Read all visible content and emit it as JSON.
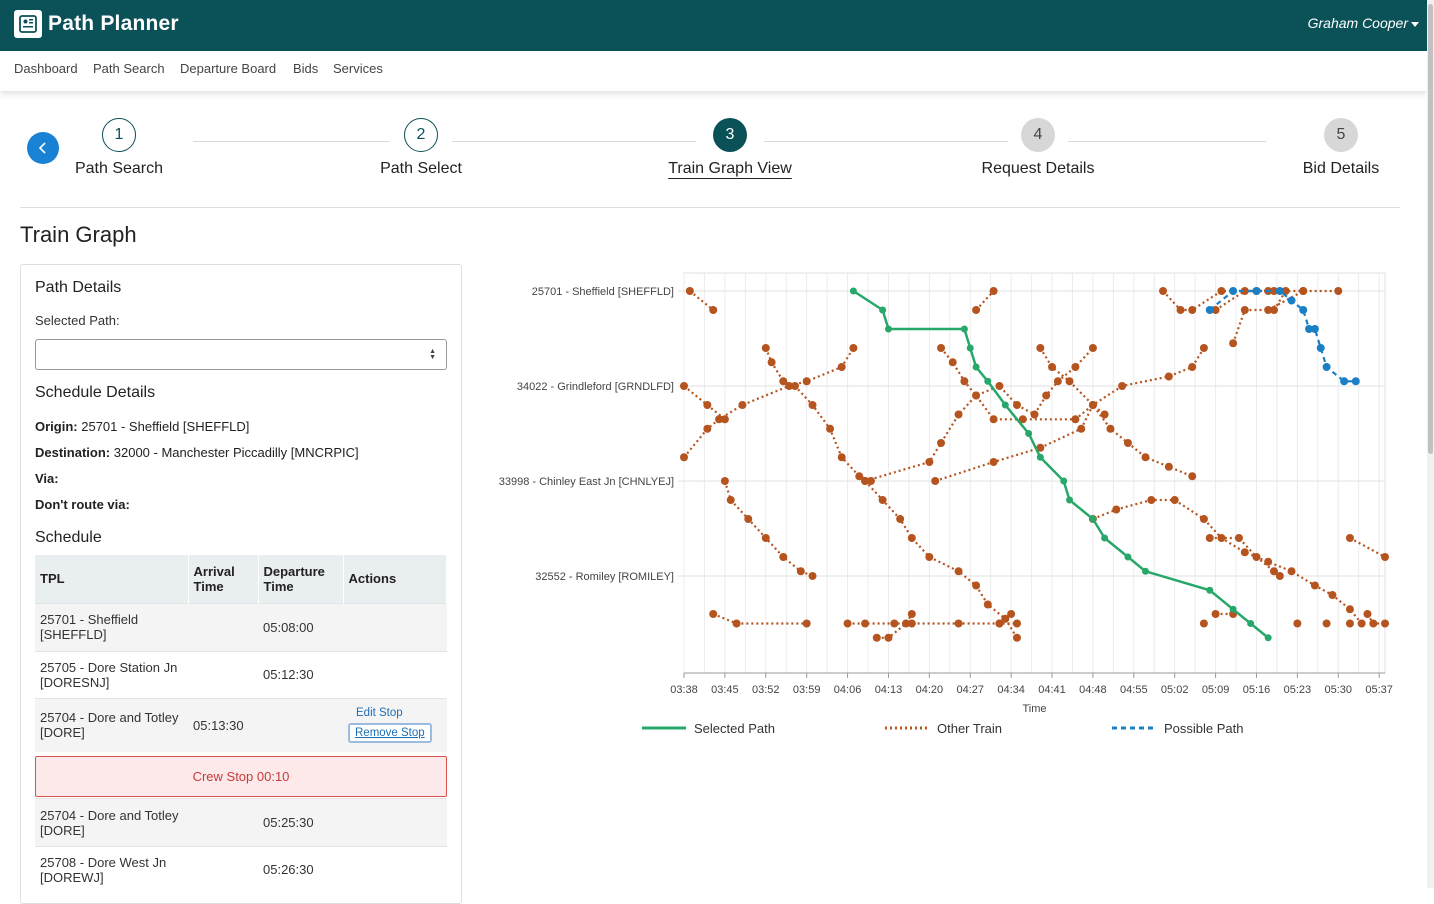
{
  "app": {
    "title": "Path Planner",
    "user": "Graham Cooper"
  },
  "nav": {
    "items": [
      "Dashboard",
      "Path Search",
      "Departure Board",
      "Bids",
      "Services"
    ]
  },
  "stepper": {
    "steps": [
      {
        "num": "1",
        "label": "Path Search",
        "state": "done"
      },
      {
        "num": "2",
        "label": "Path Select",
        "state": "done"
      },
      {
        "num": "3",
        "label": "Train Graph View",
        "state": "active"
      },
      {
        "num": "4",
        "label": "Request Details",
        "state": "todo"
      },
      {
        "num": "5",
        "label": "Bid Details",
        "state": "todo"
      }
    ]
  },
  "page": {
    "title": "Train Graph"
  },
  "path_details": {
    "heading": "Path Details",
    "selected_path_label": "Selected Path:",
    "selected_path_value": ""
  },
  "schedule_details": {
    "heading": "Schedule Details",
    "origin_label": "Origin:",
    "origin_value": "25701 - Sheffield [SHEFFLD]",
    "destination_label": "Destination:",
    "destination_value": "32000 - Manchester Piccadilly [MNCRPIC]",
    "via_label": "Via:",
    "dont_route_label": "Don't route via:"
  },
  "schedule": {
    "heading": "Schedule",
    "columns": [
      "TPL",
      "Arrival Time",
      "Departure Time",
      "Actions"
    ],
    "rows": [
      {
        "tpl": "25701 - Sheffield [SHEFFLD]",
        "arrival": "",
        "departure": "05:08:00",
        "actions": []
      },
      {
        "tpl": "25705 - Dore Station Jn [DORESNJ]",
        "arrival": "",
        "departure": "05:12:30",
        "actions": []
      },
      {
        "tpl": "25704 - Dore and Totley [DORE]",
        "arrival": "05:13:30",
        "departure": "",
        "actions": [
          "Edit Stop",
          "Remove Stop"
        ]
      },
      {
        "tpl": "25704 - Dore and Totley [DORE]",
        "arrival": "",
        "departure": "05:25:30",
        "actions": []
      },
      {
        "tpl": "25708 - Dore West Jn [DOREWJ]",
        "arrival": "",
        "departure": "05:26:30",
        "actions": []
      }
    ],
    "crew_stop": "Crew Stop 00:10"
  },
  "colors": {
    "selected": "#27a86a",
    "other": "#b5541f",
    "possible": "#1a7fc4",
    "header": "#0b5158"
  },
  "chart_data": {
    "type": "line",
    "xlabel": "Time",
    "x_ticks": [
      "03:38",
      "03:45",
      "03:52",
      "03:59",
      "04:06",
      "04:13",
      "04:20",
      "04:27",
      "04:34",
      "04:41",
      "04:48",
      "04:55",
      "05:02",
      "05:09",
      "05:16",
      "05:23",
      "05:30",
      "05:37"
    ],
    "xlim": [
      "03:38",
      "05:38"
    ],
    "y_stations": [
      "25701 - Sheffield [SHEFFLD]",
      "34022 - Grindleford [GRNDLFD]",
      "33998 - Chinley East Jn [CHNLYEJ]",
      "32552 - Romiley [ROMILEY]"
    ],
    "ylim": [
      0,
      4
    ],
    "legend": [
      "Selected Path",
      "Other Train",
      "Possible Path"
    ],
    "series": [
      {
        "name": "Selected Path",
        "style": "selected",
        "points": [
          [
            "04:07",
            0.0
          ],
          [
            "04:12",
            0.2
          ],
          [
            "04:13",
            0.4
          ],
          [
            "04:26",
            0.4
          ],
          [
            "04:27",
            0.6
          ],
          [
            "04:28",
            0.8
          ],
          [
            "04:30",
            0.95
          ],
          [
            "04:33",
            1.2
          ],
          [
            "04:37",
            1.5
          ],
          [
            "04:39",
            1.75
          ],
          [
            "04:43",
            2.0
          ],
          [
            "04:44",
            2.2
          ],
          [
            "04:48",
            2.4
          ],
          [
            "04:50",
            2.6
          ],
          [
            "04:54",
            2.8
          ],
          [
            "04:57",
            2.95
          ],
          [
            "05:08",
            3.15
          ],
          [
            "05:12",
            3.35
          ],
          [
            "05:15",
            3.5
          ],
          [
            "05:18",
            3.65
          ]
        ]
      },
      {
        "name": "Possible Path",
        "style": "possible",
        "points": [
          [
            "05:08",
            0.2
          ],
          [
            "05:12",
            0.0
          ],
          [
            "05:16",
            0.0
          ],
          [
            "05:20",
            0.0
          ],
          [
            "05:22",
            0.1
          ],
          [
            "05:24",
            0.2
          ],
          [
            "05:25",
            0.4
          ],
          [
            "05:26",
            0.4
          ],
          [
            "05:27",
            0.6
          ],
          [
            "05:28",
            0.8
          ],
          [
            "05:31",
            0.95
          ],
          [
            "05:33",
            0.95
          ]
        ]
      },
      {
        "name": "Other Train",
        "style": "other",
        "points": [
          [
            "03:39",
            0.0
          ],
          [
            "03:43",
            0.2
          ]
        ]
      },
      {
        "name": "Other Train",
        "style": "other",
        "points": [
          [
            "04:28",
            0.2
          ],
          [
            "04:31",
            0.0
          ]
        ]
      },
      {
        "name": "Other Train",
        "style": "other",
        "points": [
          [
            "05:00",
            0.0
          ],
          [
            "05:03",
            0.2
          ],
          [
            "05:05",
            0.2
          ],
          [
            "05:10",
            0.0
          ],
          [
            "05:16",
            0.0
          ],
          [
            "05:18",
            0.0
          ]
        ]
      },
      {
        "name": "Other Train",
        "style": "other",
        "points": [
          [
            "05:09",
            0.2
          ],
          [
            "05:14",
            0.0
          ],
          [
            "05:19",
            0.0
          ]
        ]
      },
      {
        "name": "Other Train",
        "style": "other",
        "points": [
          [
            "05:12",
            0.55
          ],
          [
            "05:14",
            0.2
          ],
          [
            "05:18",
            0.2
          ],
          [
            "05:24",
            0.0
          ],
          [
            "05:30",
            0.0
          ]
        ]
      },
      {
        "name": "Other Train",
        "style": "other",
        "points": [
          [
            "05:19",
            0.2
          ],
          [
            "05:21",
            0.0
          ],
          [
            "05:24",
            0.0
          ]
        ]
      },
      {
        "name": "Other Train",
        "style": "other",
        "points": [
          [
            "03:52",
            0.6
          ],
          [
            "03:53",
            0.75
          ],
          [
            "03:55",
            0.95
          ],
          [
            "03:57",
            1.0
          ],
          [
            "04:00",
            1.2
          ],
          [
            "04:03",
            1.45
          ],
          [
            "04:05",
            1.75
          ],
          [
            "04:08",
            1.95
          ],
          [
            "04:10",
            2.0
          ]
        ]
      },
      {
        "name": "Other Train",
        "style": "other",
        "points": [
          [
            "03:38",
            1.0
          ],
          [
            "03:42",
            1.2
          ],
          [
            "03:45",
            1.35
          ]
        ]
      },
      {
        "name": "Other Train",
        "style": "other",
        "points": [
          [
            "03:38",
            1.75
          ],
          [
            "03:42",
            1.45
          ],
          [
            "03:44",
            1.35
          ],
          [
            "03:48",
            1.2
          ],
          [
            "03:56",
            1.0
          ],
          [
            "03:59",
            0.95
          ],
          [
            "04:05",
            0.8
          ],
          [
            "04:07",
            0.6
          ]
        ]
      },
      {
        "name": "Other Train",
        "style": "other",
        "points": [
          [
            "04:09",
            2.0
          ],
          [
            "04:20",
            1.8
          ],
          [
            "04:22",
            1.6
          ],
          [
            "04:25",
            1.3
          ],
          [
            "04:28",
            1.1
          ],
          [
            "04:32",
            1.0
          ],
          [
            "04:35",
            1.2
          ],
          [
            "04:38",
            1.3
          ],
          [
            "04:40",
            1.1
          ],
          [
            "04:42",
            0.95
          ],
          [
            "04:45",
            0.8
          ],
          [
            "04:48",
            0.6
          ]
        ]
      },
      {
        "name": "Other Train",
        "style": "other",
        "points": [
          [
            "04:22",
            0.6
          ],
          [
            "04:24",
            0.75
          ],
          [
            "04:26",
            0.95
          ],
          [
            "04:28",
            1.1
          ],
          [
            "04:31",
            1.35
          ],
          [
            "04:36",
            1.35
          ],
          [
            "04:45",
            1.35
          ],
          [
            "04:48",
            1.2
          ],
          [
            "04:51",
            1.45
          ],
          [
            "04:54",
            1.6
          ],
          [
            "04:57",
            1.75
          ],
          [
            "05:01",
            1.85
          ],
          [
            "05:05",
            1.95
          ]
        ]
      },
      {
        "name": "Other Train",
        "style": "other",
        "points": [
          [
            "04:21",
            2.0
          ],
          [
            "04:31",
            1.8
          ],
          [
            "04:39",
            1.65
          ],
          [
            "04:46",
            1.45
          ],
          [
            "04:48",
            1.2
          ],
          [
            "04:53",
            1.0
          ],
          [
            "05:01",
            0.9
          ],
          [
            "05:05",
            0.8
          ],
          [
            "05:07",
            0.6
          ]
        ]
      },
      {
        "name": "Other Train",
        "style": "other",
        "points": [
          [
            "04:39",
            0.6
          ],
          [
            "04:41",
            0.8
          ],
          [
            "04:44",
            0.95
          ],
          [
            "04:48",
            1.2
          ],
          [
            "04:50",
            1.3
          ]
        ]
      },
      {
        "name": "Other Train",
        "style": "other",
        "points": [
          [
            "03:45",
            2.0
          ],
          [
            "03:46",
            2.2
          ],
          [
            "03:49",
            2.4
          ],
          [
            "03:52",
            2.6
          ],
          [
            "03:55",
            2.8
          ],
          [
            "03:58",
            2.95
          ],
          [
            "04:00",
            3.0
          ]
        ]
      },
      {
        "name": "Other Train",
        "style": "other",
        "points": [
          [
            "04:09",
            2.0
          ],
          [
            "04:12",
            2.2
          ],
          [
            "04:15",
            2.4
          ],
          [
            "04:17",
            2.6
          ],
          [
            "04:20",
            2.8
          ],
          [
            "04:25",
            2.95
          ],
          [
            "04:28",
            3.1
          ],
          [
            "04:30",
            3.3
          ],
          [
            "04:33",
            3.45
          ],
          [
            "04:35",
            3.65
          ]
        ]
      },
      {
        "name": "Other Train",
        "style": "other",
        "points": [
          [
            "04:48",
            2.4
          ],
          [
            "04:52",
            2.3
          ],
          [
            "04:58",
            2.2
          ],
          [
            "05:02",
            2.2
          ],
          [
            "05:07",
            2.4
          ],
          [
            "05:10",
            2.6
          ],
          [
            "05:14",
            2.75
          ],
          [
            "05:18",
            2.85
          ],
          [
            "05:22",
            2.95
          ],
          [
            "05:26",
            3.1
          ],
          [
            "05:29",
            3.2
          ],
          [
            "05:32",
            3.35
          ],
          [
            "05:34",
            3.5
          ]
        ]
      },
      {
        "name": "Other Train",
        "style": "other",
        "points": [
          [
            "05:08",
            2.6
          ],
          [
            "05:13",
            2.6
          ],
          [
            "05:16",
            2.8
          ],
          [
            "05:19",
            2.95
          ],
          [
            "05:20",
            3.0
          ]
        ]
      },
      {
        "name": "Other Train",
        "style": "other",
        "points": [
          [
            "05:32",
            2.6
          ],
          [
            "05:38",
            2.8
          ]
        ]
      },
      {
        "name": "Other Train",
        "style": "other",
        "points": [
          [
            "03:43",
            3.4
          ],
          [
            "03:47",
            3.5
          ],
          [
            "03:59",
            3.5
          ]
        ]
      },
      {
        "name": "Other Train",
        "style": "other",
        "points": [
          [
            "04:06",
            3.5
          ],
          [
            "04:09",
            3.5
          ],
          [
            "04:14",
            3.5
          ],
          [
            "04:17",
            3.5
          ],
          [
            "04:25",
            3.5
          ],
          [
            "04:32",
            3.5
          ],
          [
            "04:35",
            3.5
          ]
        ]
      },
      {
        "name": "Other Train",
        "style": "other",
        "points": [
          [
            "04:11",
            3.65
          ],
          [
            "04:13",
            3.65
          ],
          [
            "04:16",
            3.5
          ],
          [
            "04:17",
            3.4
          ]
        ]
      },
      {
        "name": "Other Train",
        "style": "other",
        "points": [
          [
            "04:32",
            3.5
          ],
          [
            "04:34",
            3.4
          ]
        ]
      },
      {
        "name": "Other Train",
        "style": "other",
        "points": [
          [
            "05:09",
            3.4
          ],
          [
            "05:12",
            3.4
          ]
        ]
      },
      {
        "name": "Other Train",
        "style": "other",
        "points": [
          [
            "05:07",
            3.5
          ]
        ]
      },
      {
        "name": "Other Train",
        "style": "other",
        "points": [
          [
            "05:23",
            3.5
          ]
        ]
      },
      {
        "name": "Other Train",
        "style": "other",
        "points": [
          [
            "05:28",
            3.5
          ]
        ]
      },
      {
        "name": "Other Train",
        "style": "other",
        "points": [
          [
            "05:32",
            3.5
          ]
        ]
      },
      {
        "name": "Other Train",
        "style": "other",
        "points": [
          [
            "05:35",
            3.4
          ],
          [
            "05:36",
            3.5
          ],
          [
            "05:38",
            3.5
          ]
        ]
      }
    ]
  }
}
